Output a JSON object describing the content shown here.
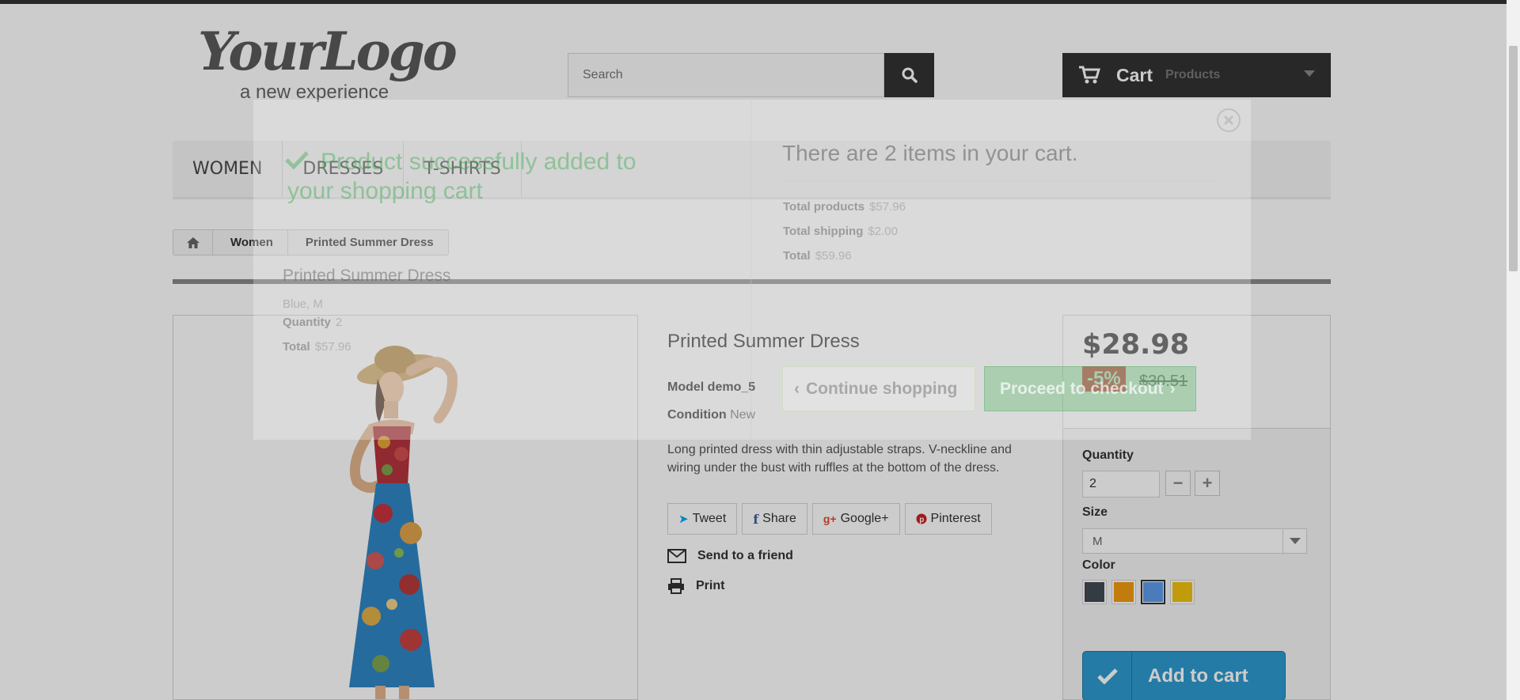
{
  "header": {
    "logo_main": "YourLogo",
    "logo_sub": "a new experience",
    "search_placeholder": "Search",
    "cart_label": "Cart",
    "cart_products": "Products"
  },
  "menu": [
    "WOMEN",
    "DRESSES",
    "T-SHIRTS"
  ],
  "breadcrumb": [
    "Women",
    "Printed Summer Dress"
  ],
  "product": {
    "title": "Printed Summer Dress",
    "model_label": "Model",
    "model_value": "demo_5",
    "condition_label": "Condition",
    "condition_value": "New",
    "description": "Long printed dress with thin adjustable straps. V-neckline and wiring under the bust with ruffles at the bottom of the dress.",
    "price": "$28.98",
    "discount": "-5%",
    "old_price": "$30.51",
    "quantity_label": "Quantity",
    "quantity_value": "2",
    "size_label": "Size",
    "size_value": "M",
    "color_label": "Color",
    "colors": [
      "#434a54",
      "#f39c11",
      "#5d9cec",
      "#f1c40f"
    ],
    "selected_color_index": 2,
    "add_to_cart": "Add to cart"
  },
  "social": [
    "Tweet",
    "Share",
    "Google+",
    "Pinterest"
  ],
  "actions": {
    "send": "Send to a friend",
    "print": "Print"
  },
  "modal": {
    "heading": "Product successfully added to your shopping cart",
    "product_name": "Printed Summer Dress",
    "attributes": "Blue, M",
    "quantity_label": "Quantity",
    "quantity_value": "2",
    "total_label": "Total",
    "total_value": "$57.96",
    "cart_count": "There are 2 items in your cart.",
    "total_products_label": "Total products",
    "total_products_value": "$57.96",
    "total_shipping_label": "Total shipping",
    "total_shipping_value": "$2.00",
    "grand_total_label": "Total",
    "grand_total_value": "$59.96",
    "continue": "Continue shopping",
    "proceed": "Proceed to checkout"
  }
}
